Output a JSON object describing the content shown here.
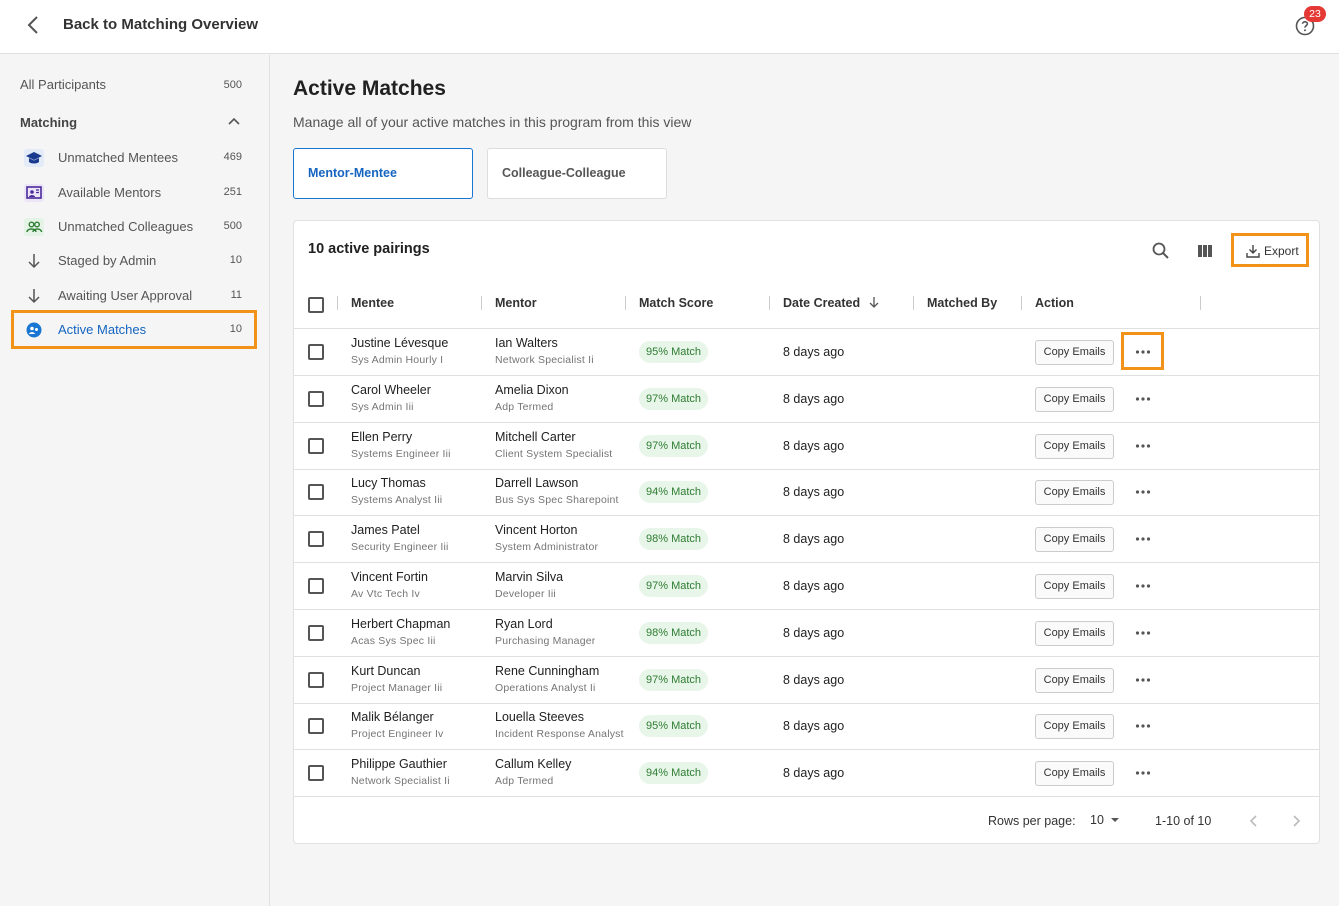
{
  "header": {
    "back_label": "Back to Matching Overview",
    "notification_count": "23"
  },
  "sidebar": {
    "all_participants": {
      "label": "All Participants",
      "count": "500"
    },
    "section_title": "Matching",
    "items": [
      {
        "label": "Unmatched Mentees",
        "count": "469",
        "icon": "graduation-cap-icon"
      },
      {
        "label": "Available Mentors",
        "count": "251",
        "icon": "presentation-icon"
      },
      {
        "label": "Unmatched Colleagues",
        "count": "500",
        "icon": "people-icon"
      },
      {
        "label": "Staged by Admin",
        "count": "10",
        "icon": "arrow-down-icon"
      },
      {
        "label": "Awaiting User Approval",
        "count": "11",
        "icon": "arrow-down-icon"
      },
      {
        "label": "Active Matches",
        "count": "10",
        "icon": "active-matches-icon"
      }
    ]
  },
  "main": {
    "title": "Active Matches",
    "subtitle": "Manage all of your active matches in this program from this view",
    "tabs": [
      "Mentor-Mentee",
      "Colleague-Colleague"
    ],
    "active_tab": "Mentor-Mentee"
  },
  "table": {
    "title": "10 active pairings",
    "export_label": "Export",
    "columns": [
      "Mentee",
      "Mentor",
      "Match Score",
      "Date Created",
      "Matched By",
      "Action"
    ],
    "rows": [
      {
        "mentee": "Justine Lévesque",
        "mentee_role": "Sys Admin Hourly I",
        "mentor": "Ian Walters",
        "mentor_role": "Network Specialist Ii",
        "score": "95% Match",
        "date": "8 days ago",
        "action": "Copy Emails"
      },
      {
        "mentee": "Carol Wheeler",
        "mentee_role": "Sys Admin Iii",
        "mentor": "Amelia Dixon",
        "mentor_role": "Adp Termed",
        "score": "97% Match",
        "date": "8 days ago",
        "action": "Copy Emails"
      },
      {
        "mentee": "Ellen Perry",
        "mentee_role": "Systems Engineer Iii",
        "mentor": "Mitchell Carter",
        "mentor_role": "Client System Specialist",
        "score": "97% Match",
        "date": "8 days ago",
        "action": "Copy Emails"
      },
      {
        "mentee": "Lucy Thomas",
        "mentee_role": "Systems Analyst Iii",
        "mentor": "Darrell Lawson",
        "mentor_role": "Bus Sys Spec Sharepoint",
        "score": "94% Match",
        "date": "8 days ago",
        "action": "Copy Emails"
      },
      {
        "mentee": "James Patel",
        "mentee_role": "Security Engineer Iii",
        "mentor": "Vincent Horton",
        "mentor_role": "System Administrator",
        "score": "98% Match",
        "date": "8 days ago",
        "action": "Copy Emails"
      },
      {
        "mentee": "Vincent Fortin",
        "mentee_role": "Av Vtc Tech Iv",
        "mentor": "Marvin Silva",
        "mentor_role": "Developer Iii",
        "score": "97% Match",
        "date": "8 days ago",
        "action": "Copy Emails"
      },
      {
        "mentee": "Herbert Chapman",
        "mentee_role": "Acas Sys Spec Iii",
        "mentor": "Ryan Lord",
        "mentor_role": "Purchasing Manager",
        "score": "98% Match",
        "date": "8 days ago",
        "action": "Copy Emails"
      },
      {
        "mentee": "Kurt Duncan",
        "mentee_role": "Project Manager Iii",
        "mentor": "Rene Cunningham",
        "mentor_role": "Operations Analyst Ii",
        "score": "97% Match",
        "date": "8 days ago",
        "action": "Copy Emails"
      },
      {
        "mentee": "Malik Bélanger",
        "mentee_role": "Project Engineer Iv",
        "mentor": "Louella Steeves",
        "mentor_role": "Incident Response Analyst",
        "score": "95% Match",
        "date": "8 days ago",
        "action": "Copy Emails"
      },
      {
        "mentee": "Philippe Gauthier",
        "mentee_role": "Network Specialist Ii",
        "mentor": "Callum Kelley",
        "mentor_role": "Adp Termed",
        "score": "94% Match",
        "date": "8 days ago",
        "action": "Copy Emails"
      }
    ],
    "footer": {
      "rows_per_page_label": "Rows per page:",
      "rows_per_page": "10",
      "range": "1-10 of 10"
    }
  },
  "colors": {
    "accent": "#1976d2",
    "highlight": "#f39218",
    "badge": "#e53935",
    "score_bg": "#e8f5e9",
    "score_text": "#2e7d32"
  }
}
